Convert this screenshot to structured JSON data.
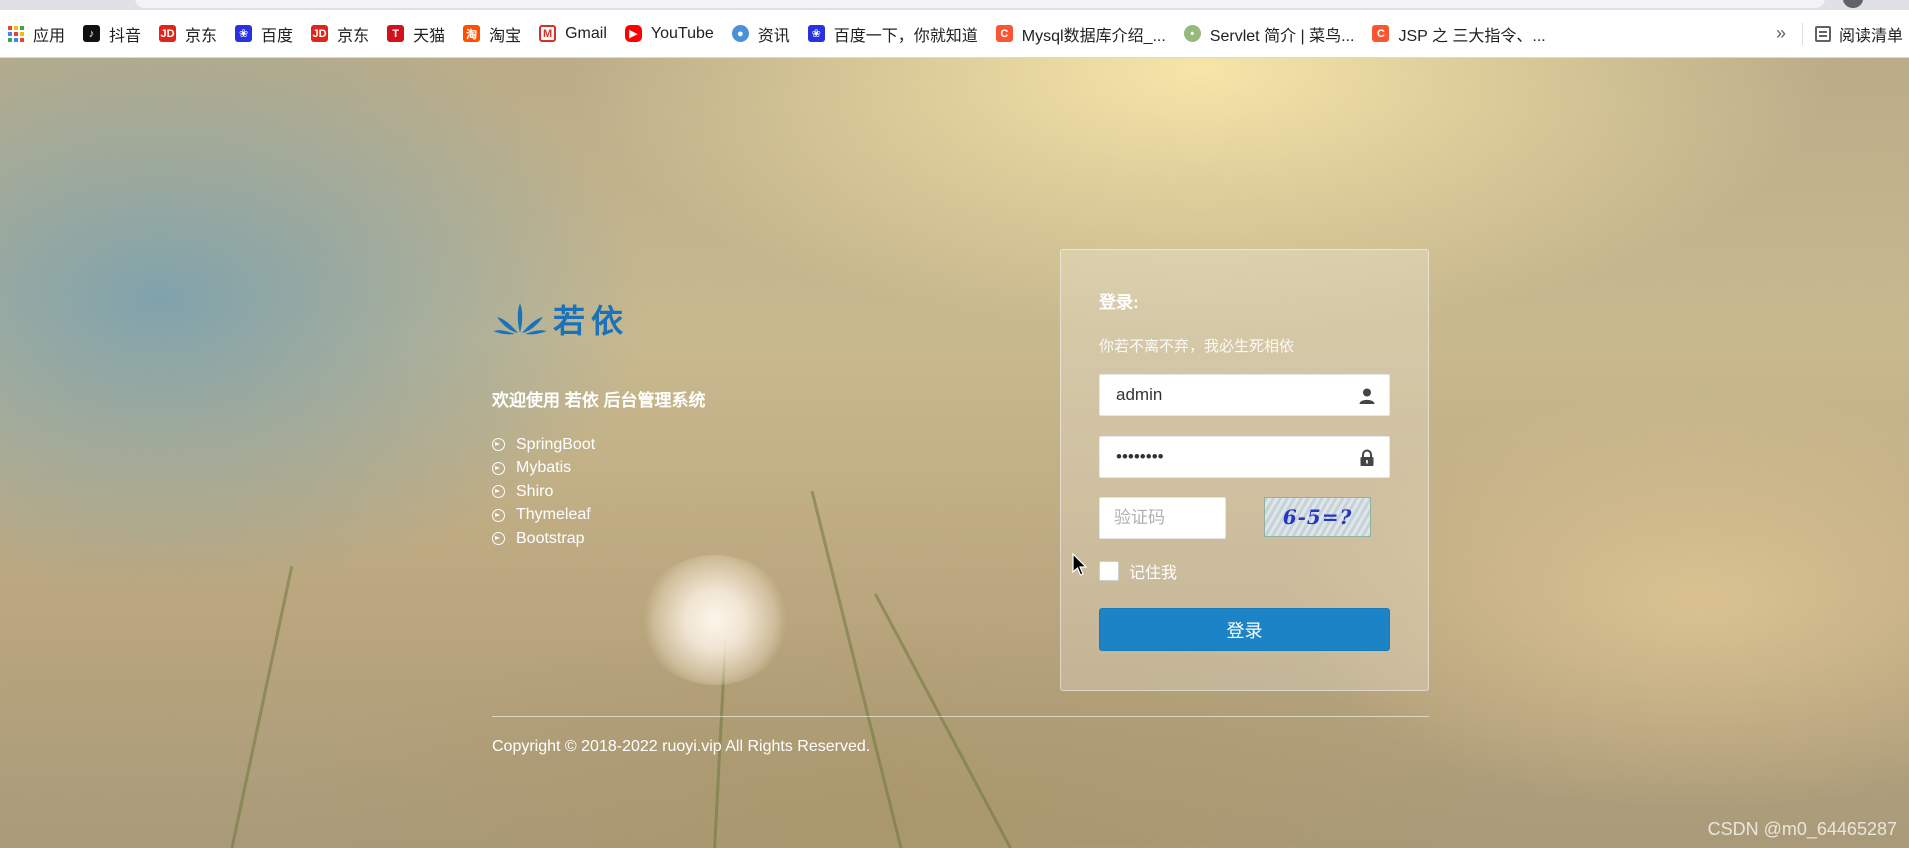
{
  "bookmarks": [
    {
      "label": "应用",
      "icon": "apps-grid-icon"
    },
    {
      "label": "抖音",
      "icon": "douyin-icon",
      "color": "#111111"
    },
    {
      "label": "京东",
      "icon": "jd-icon",
      "color": "#e1251b"
    },
    {
      "label": "百度",
      "icon": "baidu-paw-icon",
      "color": "#2932e1"
    },
    {
      "label": "京东",
      "icon": "jd-icon",
      "color": "#e1251b"
    },
    {
      "label": "天猫",
      "icon": "tmall-icon",
      "color": "#d4101b"
    },
    {
      "label": "淘宝",
      "icon": "taobao-icon",
      "color": "#ff5000"
    },
    {
      "label": "Gmail",
      "icon": "gmail-icon",
      "color": "#d93025"
    },
    {
      "label": "YouTube",
      "icon": "youtube-icon",
      "color": "#ff0000"
    },
    {
      "label": "资讯",
      "icon": "news-icon",
      "color": "#4a90d9"
    },
    {
      "label": "百度一下，你就知道",
      "icon": "baidu-paw-icon",
      "color": "#2932e1"
    },
    {
      "label": "Mysql数据库介绍_...",
      "icon": "csdn-icon",
      "color": "#fc5531"
    },
    {
      "label": "Servlet 简介 | 菜鸟...",
      "icon": "runoob-icon",
      "color": "#96b97d"
    },
    {
      "label": "JSP 之 三大指令、...",
      "icon": "csdn-icon",
      "color": "#fc5531"
    }
  ],
  "bookmarks_more": "»",
  "reading_list": "阅读清单",
  "brand": {
    "logo_text": "若依",
    "color": "#1b72b8"
  },
  "welcome": "欢迎使用 若依 后台管理系统",
  "features": [
    "SpringBoot",
    "Mybatis",
    "Shiro",
    "Thymeleaf",
    "Bootstrap"
  ],
  "login": {
    "title": "登录:",
    "subtitle": "你若不离不弃，我必生死相依",
    "username_value": "admin",
    "password_value": "••••••••",
    "captcha_placeholder": "验证码",
    "captcha_text": "6-5=?",
    "remember_label": "记住我",
    "submit_label": "登录",
    "button_color": "#1c84c6"
  },
  "copyright": "Copyright © 2018-2022 ruoyi.vip All Rights Reserved.",
  "watermark": "CSDN @m0_64465287"
}
